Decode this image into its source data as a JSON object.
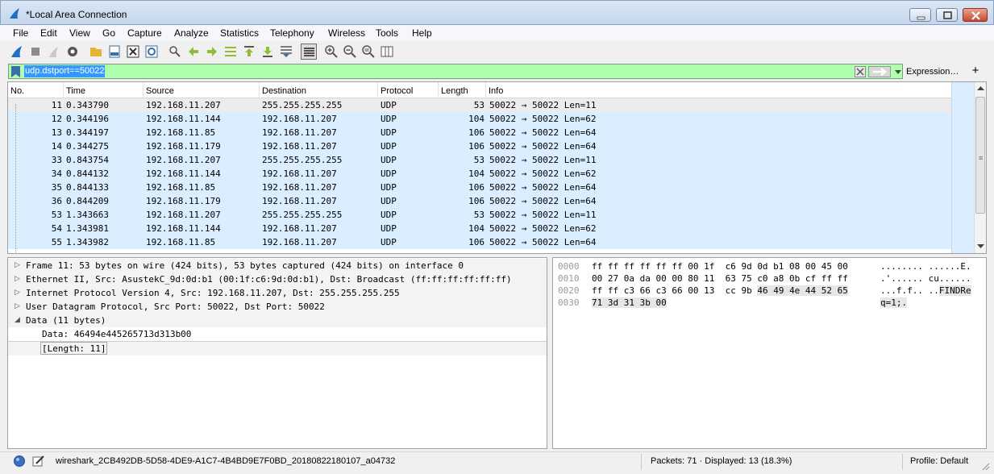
{
  "window": {
    "title": "*Local Area Connection"
  },
  "menu": [
    "File",
    "Edit",
    "View",
    "Go",
    "Capture",
    "Analyze",
    "Statistics",
    "Telephony",
    "Wireless",
    "Tools",
    "Help"
  ],
  "filter": {
    "value": "udp.dstport==50022",
    "expression_label": "Expression…",
    "add_label": "+",
    "background": "#afffaf"
  },
  "packet_list": {
    "columns": [
      "No.",
      "Time",
      "Source",
      "Destination",
      "Protocol",
      "Length",
      "Info"
    ],
    "rows": [
      {
        "no": "11",
        "time": "0.343790",
        "src": "192.168.11.207",
        "dst": "255.255.255.255",
        "proto": "UDP",
        "len": "53",
        "info": "50022 → 50022 Len=11"
      },
      {
        "no": "12",
        "time": "0.344196",
        "src": "192.168.11.144",
        "dst": "192.168.11.207",
        "proto": "UDP",
        "len": "104",
        "info": "50022 → 50022 Len=62"
      },
      {
        "no": "13",
        "time": "0.344197",
        "src": "192.168.11.85",
        "dst": "192.168.11.207",
        "proto": "UDP",
        "len": "106",
        "info": "50022 → 50022 Len=64"
      },
      {
        "no": "14",
        "time": "0.344275",
        "src": "192.168.11.179",
        "dst": "192.168.11.207",
        "proto": "UDP",
        "len": "106",
        "info": "50022 → 50022 Len=64"
      },
      {
        "no": "33",
        "time": "0.843754",
        "src": "192.168.11.207",
        "dst": "255.255.255.255",
        "proto": "UDP",
        "len": "53",
        "info": "50022 → 50022 Len=11"
      },
      {
        "no": "34",
        "time": "0.844132",
        "src": "192.168.11.144",
        "dst": "192.168.11.207",
        "proto": "UDP",
        "len": "104",
        "info": "50022 → 50022 Len=62"
      },
      {
        "no": "35",
        "time": "0.844133",
        "src": "192.168.11.85",
        "dst": "192.168.11.207",
        "proto": "UDP",
        "len": "106",
        "info": "50022 → 50022 Len=64"
      },
      {
        "no": "36",
        "time": "0.844209",
        "src": "192.168.11.179",
        "dst": "192.168.11.207",
        "proto": "UDP",
        "len": "106",
        "info": "50022 → 50022 Len=64"
      },
      {
        "no": "53",
        "time": "1.343663",
        "src": "192.168.11.207",
        "dst": "255.255.255.255",
        "proto": "UDP",
        "len": "53",
        "info": "50022 → 50022 Len=11"
      },
      {
        "no": "54",
        "time": "1.343981",
        "src": "192.168.11.144",
        "dst": "192.168.11.207",
        "proto": "UDP",
        "len": "104",
        "info": "50022 → 50022 Len=62"
      },
      {
        "no": "55",
        "time": "1.343982",
        "src": "192.168.11.85",
        "dst": "192.168.11.207",
        "proto": "UDP",
        "len": "106",
        "info": "50022 → 50022 Len=64"
      }
    ],
    "row_color": "#daeeff",
    "selected_color": "#ececec"
  },
  "details": {
    "frame": "Frame 11: 53 bytes on wire (424 bits), 53 bytes captured (424 bits) on interface 0",
    "ethernet": "Ethernet II, Src: AsustekC_9d:0d:b1 (00:1f:c6:9d:0d:b1), Dst: Broadcast (ff:ff:ff:ff:ff:ff)",
    "ip": "Internet Protocol Version 4, Src: 192.168.11.207, Dst: 255.255.255.255",
    "udp": "User Datagram Protocol, Src Port: 50022, Dst Port: 50022",
    "data": "Data (11 bytes)",
    "data_value": "Data: 46494e445265713d313b00",
    "data_length": "[Length: 11]"
  },
  "bytes": {
    "rows": [
      {
        "offset": "0000",
        "hex_a": "ff ff ff ff ff ff 00 1f",
        "hex_b": "c6 9d 0d b1 08 00 45 00",
        "ascii_a": "........",
        "ascii_b": "......E."
      },
      {
        "offset": "0010",
        "hex_a": "00 27 0a da 00 00 80 11",
        "hex_b": "63 75 c0 a8 0b cf ff ff",
        "ascii_a": ".'......",
        "ascii_b": "cu......"
      },
      {
        "offset": "0020",
        "hex_a": "ff ff c3 66 c3 66 00 13",
        "hex_b": "cc 9b 46 49 4e 44 52 65",
        "ascii_a": "...f.f..",
        "ascii_b": "..FINDRe"
      },
      {
        "offset": "0030",
        "hex_a": "71 3d 31 3b 00",
        "hex_b": "",
        "ascii_a": "q=1;.",
        "ascii_b": ""
      }
    ]
  },
  "status": {
    "file": "wireshark_2CB492DB-5D58-4DE9-A1C7-4B4BD9E7F0BD_20180822180107_a04732",
    "packets": "Packets: 71 · Displayed: 13 (18.3%)",
    "profile": "Profile: Default"
  }
}
